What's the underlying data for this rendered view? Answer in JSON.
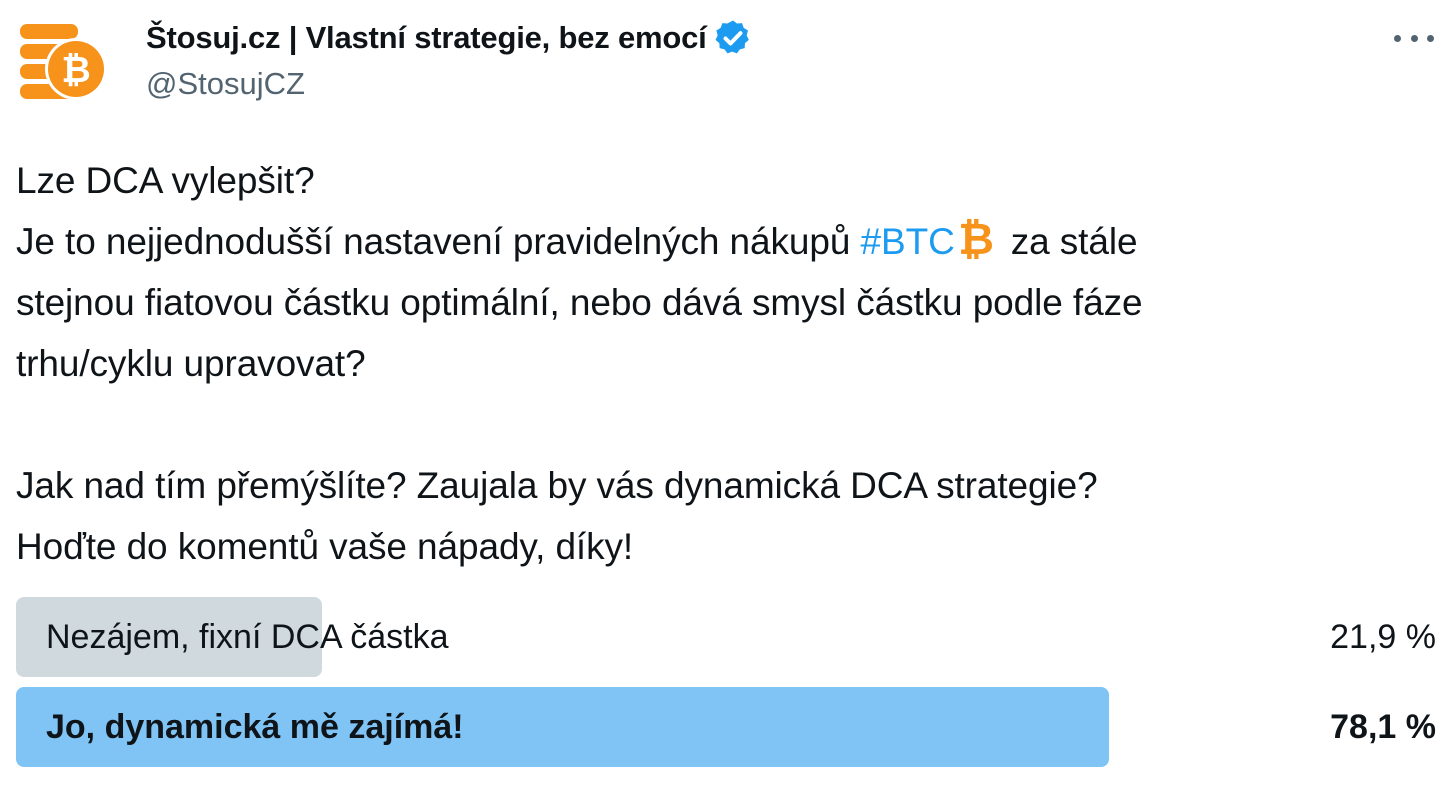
{
  "author": {
    "display_name": "Štosuj.cz | Vlastní strategie, bez emocí",
    "handle": "@StosujCZ",
    "verified": true,
    "avatar_icon": "stacked-bitcoin-coins-icon",
    "brand_color": "#f7931a"
  },
  "tweet": {
    "line1": "Lze DCA vylepšit?",
    "line2_pre": "Je to nejjednodušší nastavení pravidelných nákupů ",
    "hashtag": "#BTC",
    "line2_post": "za stále",
    "line3": "stejnou fiatovou částku optimální, nebo dává smysl částku podle fáze",
    "line4": "trhu/cyklu upravovat?",
    "line5": "Jak nad tím přemýšlíte? Zaujala by vás dynamická DCA strategie?",
    "line6": "Hoďte do komentů vaše nápady, díky!"
  },
  "poll": {
    "options": [
      {
        "label": "Nezájem, fixní DCA částka",
        "percent_text": "21,9 %",
        "percent": 21.9,
        "winner": false,
        "color": "#cfd9de"
      },
      {
        "label": "Jo, dynamická mě zajímá!",
        "percent_text": "78,1 %",
        "percent": 78.1,
        "winner": true,
        "color": "#7fc4f5"
      }
    ]
  },
  "colors": {
    "text": "#0f1419",
    "secondary": "#536471",
    "link": "#1d9bf0",
    "verified": "#1d9bf0"
  }
}
